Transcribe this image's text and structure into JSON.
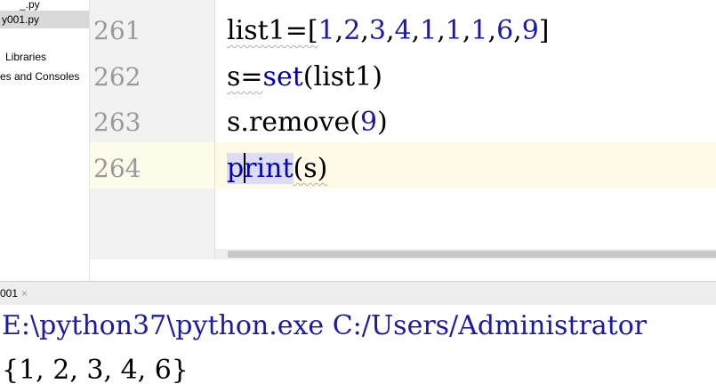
{
  "project_tree": {
    "items": [
      {
        "label": "_.py"
      },
      {
        "label": "y001.py"
      },
      {
        "label": "Libraries"
      },
      {
        "label": "es and Consoles"
      }
    ]
  },
  "editor": {
    "lines": [
      {
        "number": "261",
        "text": "list1=[1,2,3,4,1,1,1,6,9]"
      },
      {
        "number": "262",
        "text": "s=set(list1)"
      },
      {
        "number": "263",
        "text": "s.remove(9)"
      },
      {
        "number": "264",
        "text": "print(s)"
      }
    ],
    "tokens": {
      "l261": {
        "a": "list1=[",
        "n1": "1",
        "n2": "2",
        "n3": "3",
        "n4": "4",
        "n5": "1",
        "n6": "1",
        "n7": "1",
        "n8": "6",
        "n9": "9",
        "comma": ",",
        "close": "]"
      },
      "l262": {
        "a": "s=",
        "kw": "set",
        "b": "(list1)"
      },
      "l263": {
        "a": "s.remove(",
        "n": "9",
        "b": ")"
      },
      "l264": {
        "kw1": "p",
        "kw2": "rint",
        "b": "(s)"
      }
    }
  },
  "run": {
    "tab_label": "001",
    "close_glyph": "×",
    "command": "E:\\python37\\python.exe C:/Users/Administrator",
    "result": "{1, 2, 3, 4, 6}"
  },
  "colors": {
    "keyword": "#0000b4",
    "number": "#1a1aa6",
    "current_line": "#fffbe6",
    "gutter": "#f2f2f2"
  }
}
